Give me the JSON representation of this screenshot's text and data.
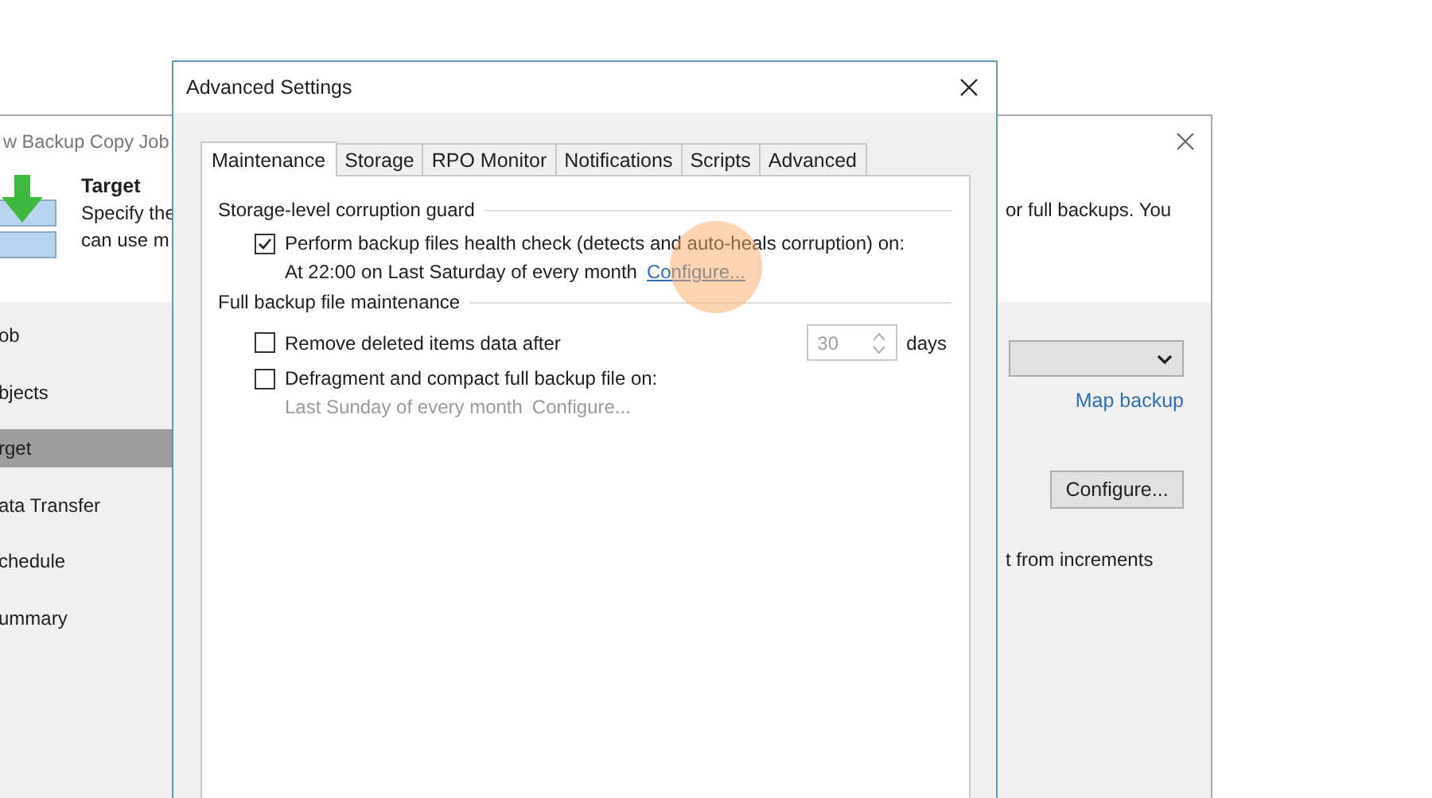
{
  "background_window": {
    "title": "w Backup Copy Job",
    "header": {
      "title": "Target",
      "description_lines": [
        "Specify the",
        "can use m"
      ],
      "description_right": "or full backups. You"
    },
    "sidebar": {
      "items": [
        {
          "label": "ob",
          "selected": false
        },
        {
          "label": "bjects",
          "selected": false
        },
        {
          "label": "rget",
          "selected": true
        },
        {
          "label": "ata Transfer",
          "selected": false
        },
        {
          "label": "chedule",
          "selected": false
        },
        {
          "label": "ummary",
          "selected": false
        }
      ]
    },
    "map_backup_link": "Map backup",
    "configure_button": "Configure...",
    "increments_text": "t from increments"
  },
  "dialog": {
    "title": "Advanced Settings",
    "tabs": [
      {
        "label": "Maintenance",
        "selected": true
      },
      {
        "label": "Storage",
        "selected": false
      },
      {
        "label": "RPO Monitor",
        "selected": false
      },
      {
        "label": "Notifications",
        "selected": false
      },
      {
        "label": "Scripts",
        "selected": false
      },
      {
        "label": "Advanced",
        "selected": false
      }
    ],
    "groups": [
      {
        "title": "Storage-level corruption guard",
        "options": [
          {
            "kind": "schedule",
            "label": "Perform backup files health check (detects and auto-heals corruption) on:",
            "checked": true,
            "schedule": "At 22:00 on Last Saturday of every month",
            "link": "Configure..."
          }
        ]
      },
      {
        "title": "Full backup file maintenance",
        "options": [
          {
            "kind": "spinner",
            "label": "Remove deleted items data after",
            "checked": false,
            "value": "30",
            "unit": "days"
          },
          {
            "kind": "schedule",
            "label": "Defragment and compact full backup file on:",
            "checked": false,
            "schedule": "Last Sunday of every month",
            "link": "Configure..."
          }
        ]
      }
    ]
  }
}
